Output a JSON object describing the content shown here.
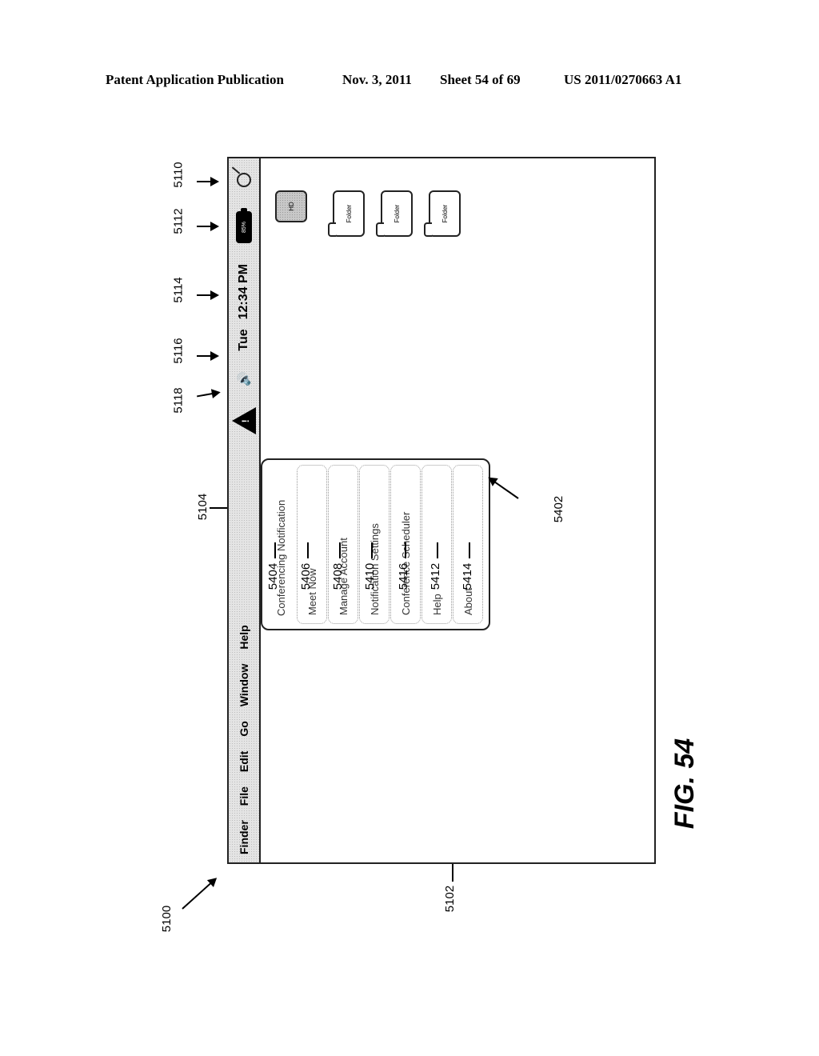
{
  "header": {
    "publication": "Patent Application Publication",
    "date": "Nov. 3, 2011",
    "sheet": "Sheet 54 of 69",
    "number": "US 2011/0270663 A1"
  },
  "menubar": {
    "items": [
      "Finder",
      "File",
      "Edit",
      "Go",
      "Window",
      "Help"
    ],
    "status": {
      "warning_icon": "warning-triangle-icon",
      "warning_glyph": "!",
      "speaker_icon": "speaker-icon",
      "day": "Tue",
      "time": "12:34 PM",
      "battery_icon": "battery-icon",
      "battery_level": "85%",
      "search_icon": "magnifier-icon"
    }
  },
  "dropdown": {
    "items": [
      "Conferencing Notification",
      "Meet Now",
      "Manage Account",
      "Notification Settings",
      "Conference Scheduler",
      "Help",
      "About"
    ]
  },
  "desktop": {
    "hd_label": "HD",
    "folders": [
      "Folder",
      "Folder",
      "Folder"
    ]
  },
  "reference_numerals": {
    "figure": "5100",
    "screen": "5102",
    "menubar": "5104",
    "search": "5110",
    "battery": "5112",
    "clock": "5114",
    "speaker": "5116",
    "warning": "5118",
    "menu": "5402",
    "items": [
      "5404",
      "5406",
      "5408",
      "5410",
      "5416",
      "5412",
      "5414"
    ]
  },
  "figure_label": "FIG. 54"
}
